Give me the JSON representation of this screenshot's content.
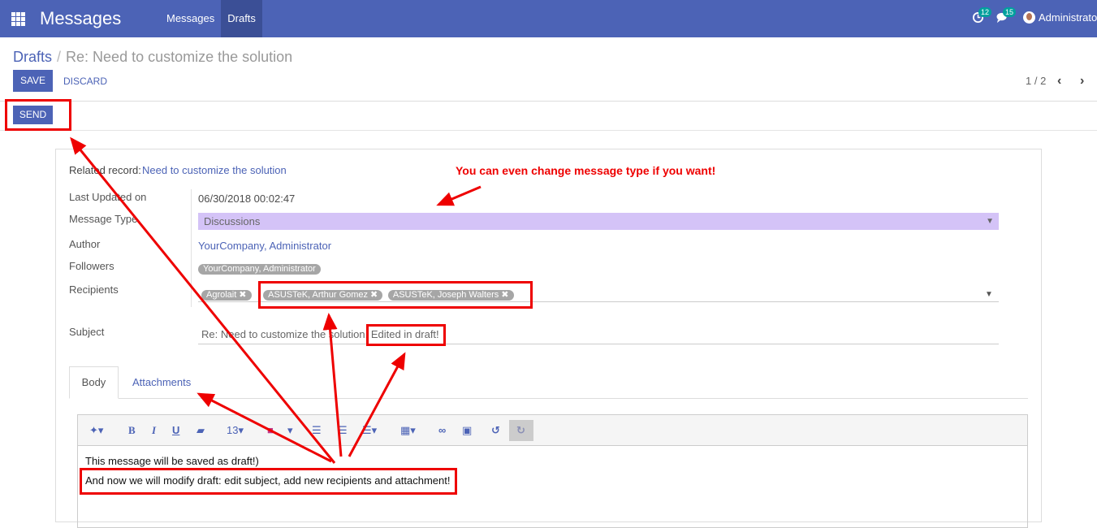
{
  "topbar": {
    "app_title": "Messages",
    "menu": [
      "Messages",
      "Drafts"
    ],
    "activity_count": "12",
    "chat_count": "15",
    "user_name": "Administrator"
  },
  "breadcrumb": {
    "parent": "Drafts",
    "current": "Re: Need to customize the solution"
  },
  "buttons": {
    "save": "SAVE",
    "discard": "DISCARD",
    "send": "SEND"
  },
  "pager": {
    "value": "1 / 2"
  },
  "form": {
    "related_record_label": "Related record:",
    "related_record_value": "Need to customize the solution",
    "last_updated_label": "Last Updated on",
    "last_updated_value": "06/30/2018 00:02:47",
    "message_type_label": "Message Type",
    "message_type_value": "Discussions",
    "author_label": "Author",
    "author_value": "YourCompany, Administrator",
    "followers_label": "Followers",
    "followers_tag": "YourCompany, Administrator",
    "recipients_label": "Recipients",
    "recipients": [
      "Agrolait",
      "ASUSTeK, Arthur Gomez",
      "ASUSTeK, Joseph Walters"
    ],
    "subject_label": "Subject",
    "subject_value": "Re: Need to customize the solution. Edited in draft!"
  },
  "tabs": [
    "Body",
    "Attachments"
  ],
  "editor": {
    "font_size": "13",
    "line1": "This message will be saved as draft!)",
    "line2": "And now we will modify draft: edit subject, add new recipients and attachment!"
  },
  "annotation": {
    "callout": "You can even change message type if you want!"
  },
  "colors": {
    "brand": "#4c63b6",
    "annotation": "#e00000",
    "message_type_bg": "#d4c3f7"
  }
}
